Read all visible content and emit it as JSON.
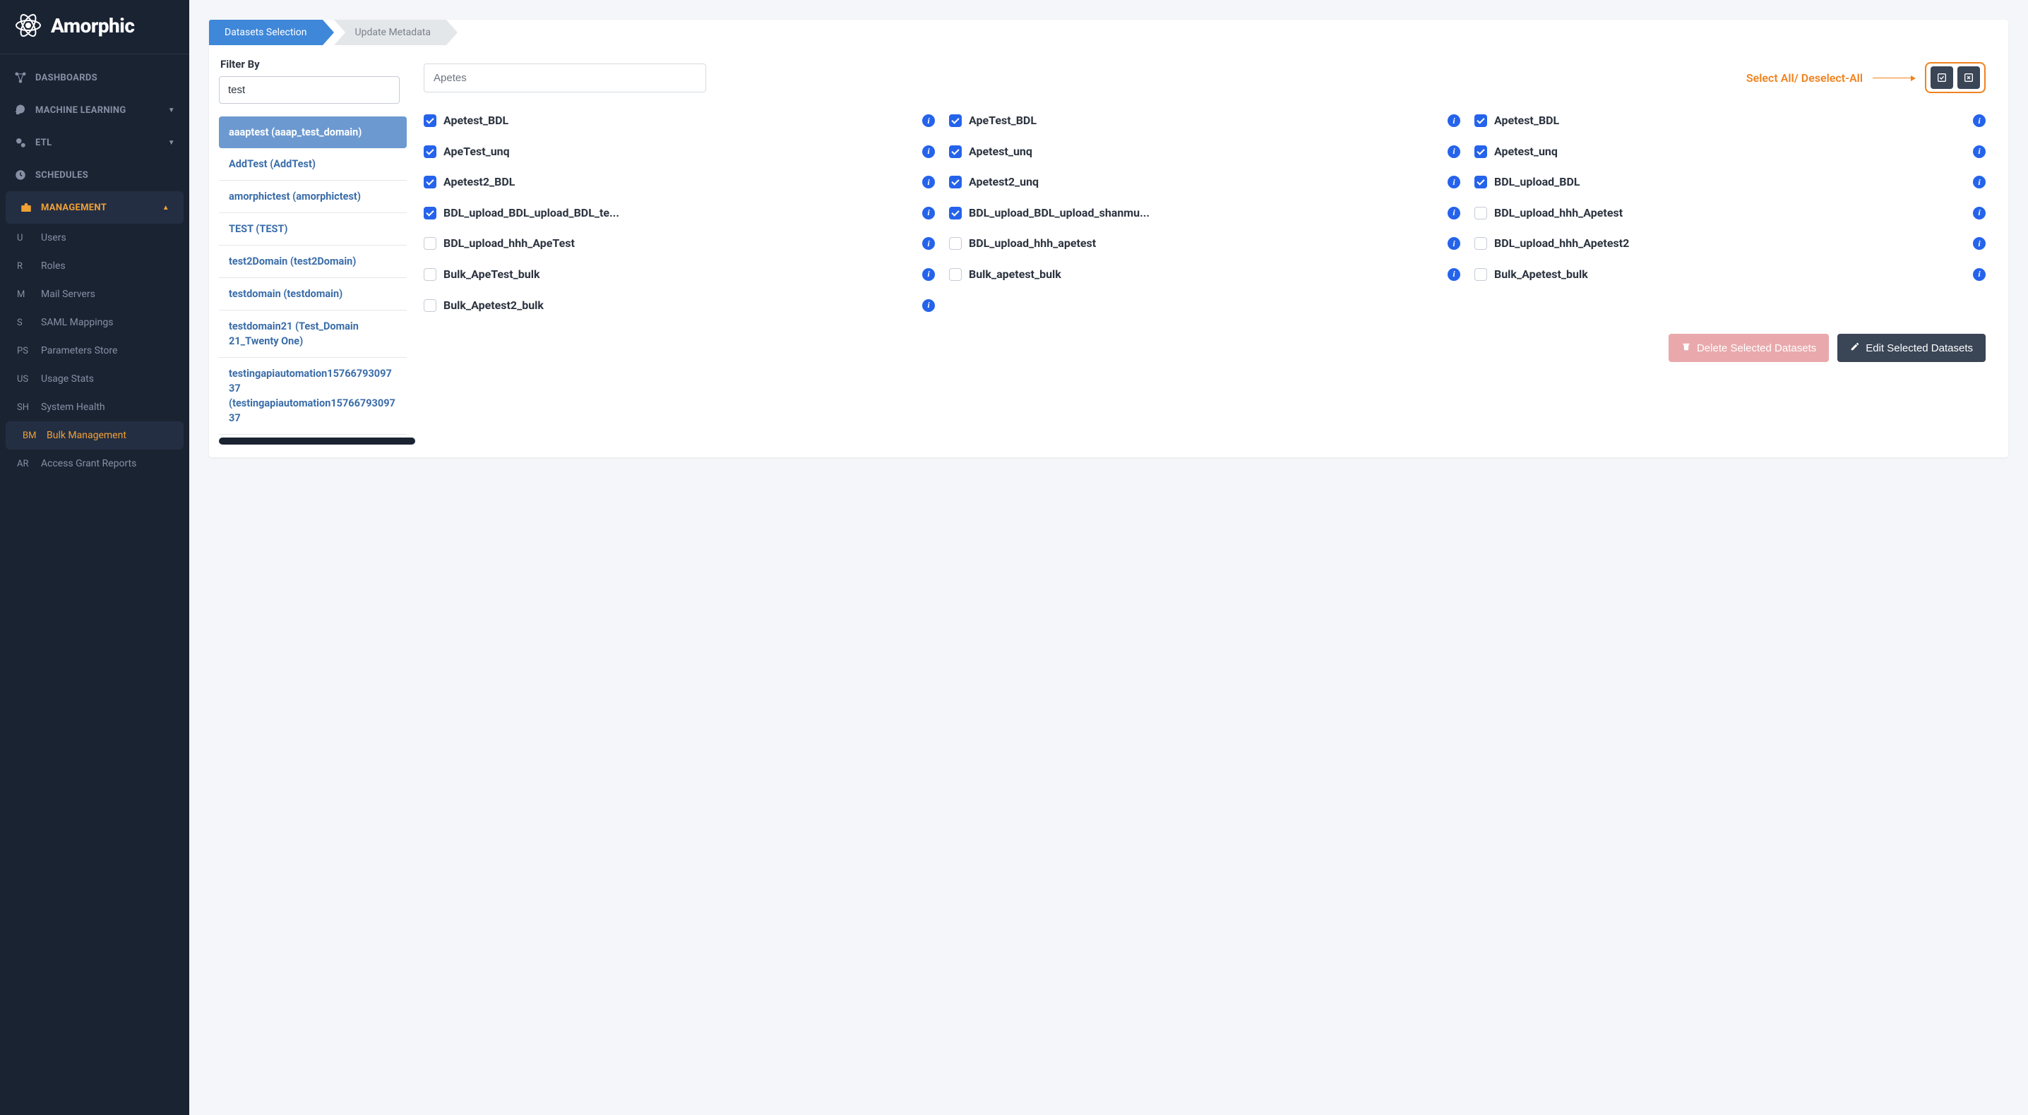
{
  "brand": {
    "title": "Amorphic"
  },
  "sidebar": {
    "items": [
      {
        "label": "DASHBOARDS",
        "icon": "network"
      },
      {
        "label": "MACHINE LEARNING",
        "icon": "head",
        "caret": true
      },
      {
        "label": "ETL",
        "icon": "gears",
        "caret": true
      },
      {
        "label": "SCHEDULES",
        "icon": "clock"
      },
      {
        "label": "MANAGEMENT",
        "icon": "briefcase",
        "caret_up": true,
        "active": true
      }
    ],
    "sub": [
      {
        "abbr": "U",
        "label": "Users"
      },
      {
        "abbr": "R",
        "label": "Roles"
      },
      {
        "abbr": "M",
        "label": "Mail Servers"
      },
      {
        "abbr": "S",
        "label": "SAML Mappings"
      },
      {
        "abbr": "PS",
        "label": "Parameters Store"
      },
      {
        "abbr": "US",
        "label": "Usage Stats"
      },
      {
        "abbr": "SH",
        "label": "System Health"
      },
      {
        "abbr": "BM",
        "label": "Bulk Management",
        "active": true
      },
      {
        "abbr": "AR",
        "label": "Access Grant Reports"
      }
    ]
  },
  "tabs": {
    "active": "Datasets Selection",
    "inactive": "Update Metadata"
  },
  "filter": {
    "label": "Filter By",
    "value": "test"
  },
  "domains": [
    {
      "label": "aaaptest (aaap_test_domain)",
      "selected": true
    },
    {
      "label": "AddTest (AddTest)"
    },
    {
      "label": "amorphictest (amorphictest)"
    },
    {
      "label": "TEST (TEST)"
    },
    {
      "label": "test2Domain (test2Domain)"
    },
    {
      "label": "testdomain (testdomain)"
    },
    {
      "label": "testdomain21 (Test_Domain 21_Twenty One)"
    },
    {
      "label": "testingapiautomation1576679309737 (testingapiautomation1576679309737"
    }
  ],
  "search": {
    "value": "Apetes"
  },
  "select_all_label": "Select All/ Deselect-All",
  "datasets": [
    {
      "label": "Apetest_BDL",
      "checked": true
    },
    {
      "label": "ApeTest_BDL",
      "checked": true
    },
    {
      "label": "Apetest_BDL",
      "checked": true
    },
    {
      "label": "ApeTest_unq",
      "checked": true
    },
    {
      "label": "Apetest_unq",
      "checked": true
    },
    {
      "label": "Apetest_unq",
      "checked": true
    },
    {
      "label": "Apetest2_BDL",
      "checked": true
    },
    {
      "label": "Apetest2_unq",
      "checked": true
    },
    {
      "label": "BDL_upload_BDL",
      "checked": true
    },
    {
      "label": "BDL_upload_BDL_upload_BDL_te...",
      "checked": true
    },
    {
      "label": "BDL_upload_BDL_upload_shanmu...",
      "checked": true
    },
    {
      "label": "BDL_upload_hhh_Apetest",
      "checked": false
    },
    {
      "label": "BDL_upload_hhh_ApeTest",
      "checked": false
    },
    {
      "label": "BDL_upload_hhh_apetest",
      "checked": false
    },
    {
      "label": "BDL_upload_hhh_Apetest2",
      "checked": false
    },
    {
      "label": "Bulk_ApeTest_bulk",
      "checked": false
    },
    {
      "label": "Bulk_apetest_bulk",
      "checked": false
    },
    {
      "label": "Bulk_Apetest_bulk",
      "checked": false
    },
    {
      "label": "Bulk_Apetest2_bulk",
      "checked": false
    }
  ],
  "actions": {
    "delete": "Delete Selected Datasets",
    "edit": "Edit Selected Datasets"
  }
}
